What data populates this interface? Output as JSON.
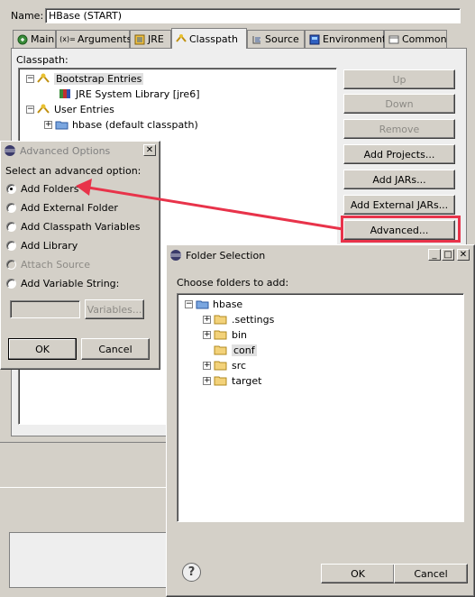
{
  "main": {
    "name_label": "Name:",
    "name_value": "HBase (START)",
    "tabs": [
      {
        "label": "Main",
        "icon": "main-tab-icon"
      },
      {
        "label": "Arguments",
        "icon": "arguments-icon"
      },
      {
        "label": "JRE",
        "icon": "jre-icon"
      },
      {
        "label": "Classpath",
        "icon": "classpath-icon",
        "active": true
      },
      {
        "label": "Source",
        "icon": "source-icon"
      },
      {
        "label": "Environment",
        "icon": "environment-icon"
      },
      {
        "label": "Common",
        "icon": "common-icon"
      }
    ],
    "classpath_label": "Classpath:",
    "tree": {
      "bootstrap": "Bootstrap Entries",
      "jre": "JRE System Library [jre6]",
      "user": "User Entries",
      "hbase": "hbase (default classpath)"
    },
    "buttons": {
      "up": "Up",
      "down": "Down",
      "remove": "Remove",
      "add_projects": "Add Projects...",
      "add_jars": "Add JARs...",
      "add_external_jars": "Add External JARs...",
      "advanced": "Advanced..."
    }
  },
  "advanced_dialog": {
    "title": "Advanced Options",
    "prompt": "Select an advanced option:",
    "options": [
      {
        "label": "Add Folders",
        "selected": true
      },
      {
        "label": "Add External Folder"
      },
      {
        "label": "Add Classpath Variables"
      },
      {
        "label": "Add Library"
      },
      {
        "label": "Attach Source",
        "disabled": true
      },
      {
        "label": "Add Variable String:"
      }
    ],
    "variables_button": "Variables...",
    "ok": "OK",
    "cancel": "Cancel"
  },
  "folder_dialog": {
    "title": "Folder Selection",
    "prompt": "Choose folders to add:",
    "root": "hbase",
    "children": [
      ".settings",
      "bin",
      "conf",
      "src",
      "target"
    ],
    "ok": "OK",
    "cancel": "Cancel"
  },
  "colors": {
    "annotation_red": "#e8334a",
    "selection": "#c8c8c8",
    "face": "#d4d0c8"
  }
}
